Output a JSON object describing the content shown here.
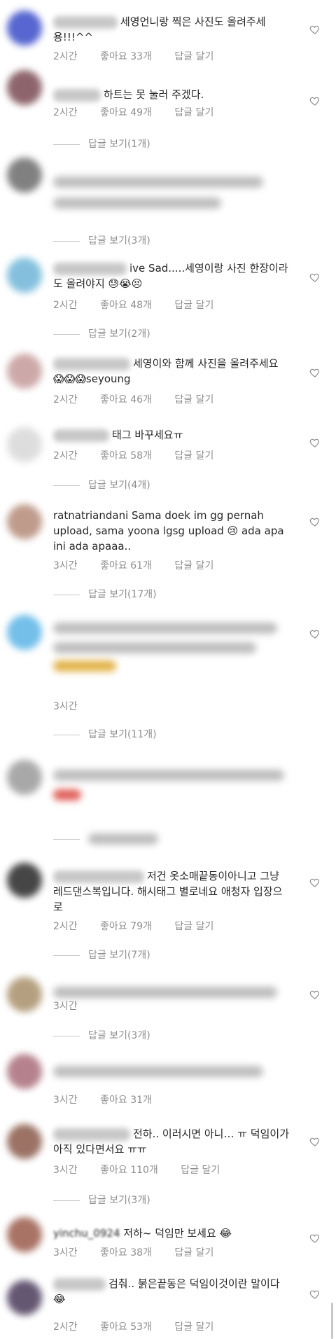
{
  "icons": {
    "heart": "heart-outline-icon"
  },
  "colors": {
    "meta": "#8e8e8e",
    "text": "#262626",
    "blur": "#c7c7c7"
  },
  "comments": [
    {
      "text": "세영언니랑 찍은 사진도 올려주세용!!!^^",
      "time": "2시간",
      "likes": "좋아요 33개",
      "reply": "답글 달기",
      "replies": ""
    },
    {
      "text": "하트는 못 눌러 주겠다.",
      "time": "2시간",
      "likes": "좋아요 49개",
      "reply": "답글 달기",
      "replies": "답글 보기(1개)"
    },
    {
      "text": "",
      "time": "",
      "likes": "",
      "reply": "",
      "replies": "답글 보기(3개)"
    },
    {
      "text": "ive Sad.....세영이랑 사진 한장이라도 올려야지 😓😭😣",
      "time": "2시간",
      "likes": "좋아요 48개",
      "reply": "답글 달기",
      "replies": "답글 보기(2개)"
    },
    {
      "text": "세영이와 함께 사진을 올려주세요 😱😱😱seyoung",
      "time": "2시간",
      "likes": "좋아요 46개",
      "reply": "답글 달기",
      "replies": ""
    },
    {
      "text": "태그 바꾸세요ㅠ",
      "time": "2시간",
      "likes": "좋아요 58개",
      "reply": "답글 달기",
      "replies": "답글 보기(4개)"
    },
    {
      "user": "ratnatriandani",
      "text": "Sama doek im gg pernah upload, sama yoona lgsg upload 😢 ada apa ini ada apaaa..",
      "time": "3시간",
      "likes": "좋아요 61개",
      "reply": "답글 달기",
      "replies": "답글 보기(17개)"
    },
    {
      "text": "",
      "time": "3시간",
      "likes": "",
      "reply": "",
      "replies": "답글 보기(11개)"
    },
    {
      "text": "",
      "time": "",
      "likes": "",
      "reply": "",
      "replies": ""
    },
    {
      "text": "저건 옷소매끝동이아니고 그냥 레드댄스복입니다. 해시태그 별로네요 애청자 입장으로",
      "time": "2시간",
      "likes": "좋아요 79개",
      "reply": "답글 달기",
      "replies": "답글 보기(7개)"
    },
    {
      "text": "",
      "time": "3시간",
      "likes": "",
      "reply": "",
      "replies": "답글 보기(3개)"
    },
    {
      "text": "",
      "time": "3시간",
      "likes": "좋아요 31개",
      "reply": "",
      "replies": ""
    },
    {
      "text": "전하.. 이러시면 아니… ㅠ 덕임이가 아직 있다면서요 ㅠㅠ",
      "time": "3시간",
      "likes": "좋아요 110개",
      "reply": "답글 달기",
      "replies": "답글 보기(3개)"
    },
    {
      "user": "yinchu_0924",
      "text": "저하~ 덕임만 보세요 😂",
      "time": "3시간",
      "likes": "좋아요 38개",
      "reply": "답글 달기",
      "replies": ""
    },
    {
      "text": "검춰.. 붉은끝동은 덕임이것이란 말이다😂",
      "time": "2시간",
      "likes": "좋아요 53개",
      "reply": "답글 달기",
      "replies": ""
    }
  ]
}
